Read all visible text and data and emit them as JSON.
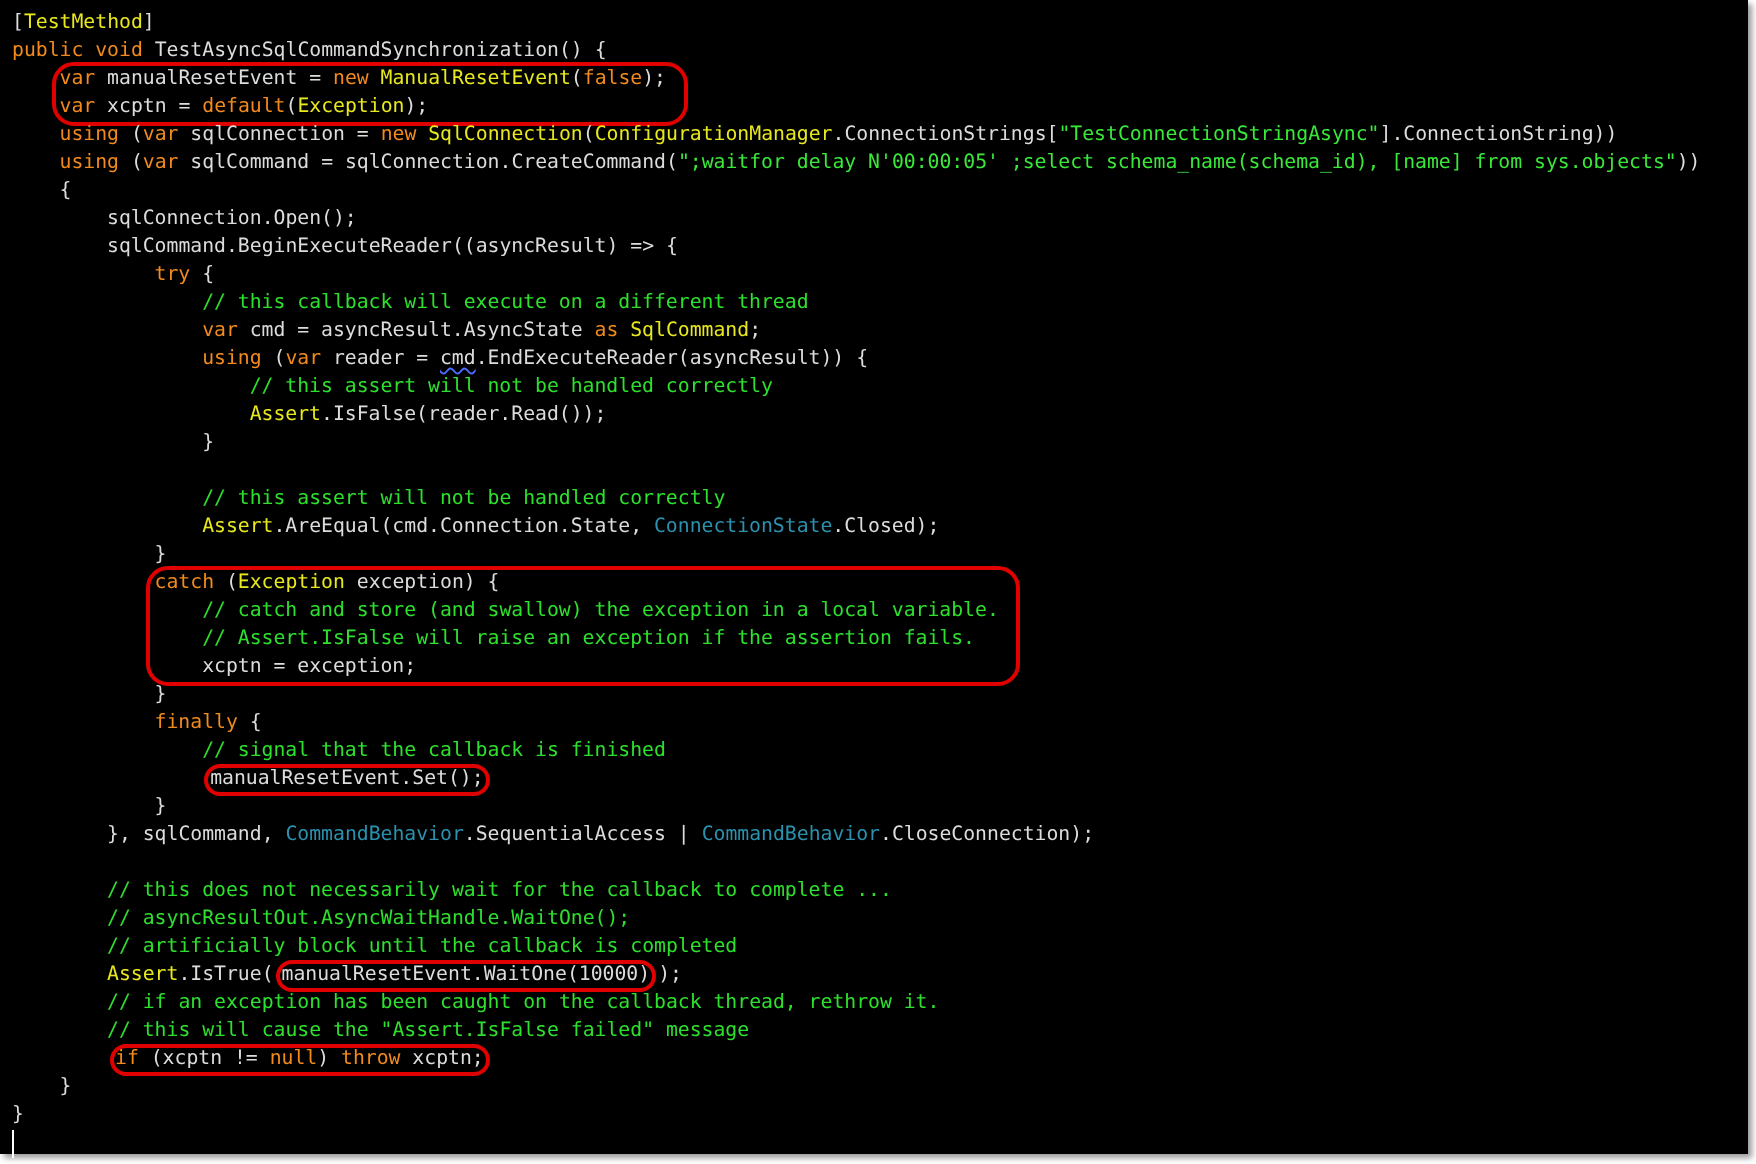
{
  "editor": {
    "lines": [
      {
        "kind": "line",
        "tokens": [
          {
            "kind": "plain",
            "text": "["
          },
          {
            "kind": "type",
            "text": "TestMethod"
          },
          {
            "kind": "plain",
            "text": "]"
          }
        ]
      },
      {
        "kind": "line",
        "tokens": [
          {
            "kind": "keyword",
            "text": "public void"
          },
          {
            "kind": "plain",
            "text": " TestAsyncSqlCommandSynchronization() {"
          }
        ],
        "children": [
          {
            "kind": "circled_group",
            "lines": [
              {
                "kind": "line",
                "tokens": [
                  {
                    "kind": "keyword",
                    "text": "var"
                  },
                  {
                    "kind": "plain",
                    "text": " manualResetEvent = "
                  },
                  {
                    "kind": "keyword",
                    "text": "new "
                  },
                  {
                    "kind": "type",
                    "text": "ManualResetEvent"
                  },
                  {
                    "kind": "plain",
                    "text": "("
                  },
                  {
                    "kind": "keyword",
                    "text": "false"
                  },
                  {
                    "kind": "plain",
                    "text": ");"
                  }
                ]
              },
              {
                "kind": "line",
                "tokens": [
                  {
                    "kind": "keyword",
                    "text": "var"
                  },
                  {
                    "kind": "plain",
                    "text": " xcptn = "
                  },
                  {
                    "kind": "keyword",
                    "text": "default"
                  },
                  {
                    "kind": "plain",
                    "text": "("
                  },
                  {
                    "kind": "type",
                    "text": "Exception"
                  },
                  {
                    "kind": "plain",
                    "text": ");"
                  }
                ]
              }
            ]
          },
          {
            "kind": "line",
            "tokens": [
              {
                "kind": "keyword",
                "text": "using"
              },
              {
                "kind": "plain",
                "text": " ("
              },
              {
                "kind": "keyword",
                "text": "var"
              },
              {
                "kind": "plain",
                "text": " sqlConnection = "
              },
              {
                "kind": "keyword",
                "text": "new "
              },
              {
                "kind": "type",
                "text": "SqlConnection"
              },
              {
                "kind": "plain",
                "text": "("
              },
              {
                "kind": "type",
                "text": "ConfigurationManager"
              },
              {
                "kind": "plain",
                "text": ".ConnectionStrings["
              },
              {
                "kind": "string",
                "text": "\"TestConnectionStringAsync\""
              },
              {
                "kind": "plain",
                "text": "].ConnectionString))"
              }
            ]
          },
          {
            "kind": "line",
            "tokens": [
              {
                "kind": "keyword",
                "text": "using"
              },
              {
                "kind": "plain",
                "text": " ("
              },
              {
                "kind": "keyword",
                "text": "var"
              },
              {
                "kind": "plain",
                "text": " sqlCommand = sqlConnection.CreateCommand("
              },
              {
                "kind": "string",
                "text": "\";waitfor delay N'00:00:05' ;select schema_name(schema_id), [name] from sys.objects\""
              },
              {
                "kind": "plain",
                "text": "))"
              }
            ]
          },
          {
            "kind": "line",
            "tokens": [
              {
                "kind": "plain",
                "text": "{"
              }
            ],
            "children": [
              {
                "kind": "line",
                "tokens": [
                  {
                    "kind": "plain",
                    "text": "sqlConnection.Open();"
                  }
                ]
              },
              {
                "kind": "line",
                "tokens": [
                  {
                    "kind": "plain",
                    "text": "sqlCommand.BeginExecuteReader((asyncResult) => {"
                  }
                ],
                "children": [
                  {
                    "kind": "line",
                    "tokens": [
                      {
                        "kind": "keyword",
                        "text": "try"
                      },
                      {
                        "kind": "plain",
                        "text": " {"
                      }
                    ],
                    "children": [
                      {
                        "kind": "line",
                        "tokens": [
                          {
                            "kind": "comment",
                            "text": "// this callback will execute on a different thread"
                          }
                        ]
                      },
                      {
                        "kind": "line",
                        "tokens": [
                          {
                            "kind": "keyword",
                            "text": "var"
                          },
                          {
                            "kind": "plain",
                            "text": " cmd = asyncResult.AsyncState "
                          },
                          {
                            "kind": "keyword",
                            "text": "as "
                          },
                          {
                            "kind": "type",
                            "text": "SqlCommand"
                          },
                          {
                            "kind": "plain",
                            "text": ";"
                          }
                        ]
                      },
                      {
                        "kind": "line",
                        "tokens": [
                          {
                            "kind": "keyword",
                            "text": "using"
                          },
                          {
                            "kind": "plain",
                            "text": " ("
                          },
                          {
                            "kind": "keyword",
                            "text": "var"
                          },
                          {
                            "kind": "plain",
                            "text": " reader = "
                          },
                          {
                            "kind": "warning",
                            "text": "cmd"
                          },
                          {
                            "kind": "plain",
                            "text": ".EndExecuteReader(asyncResult)) {"
                          }
                        ],
                        "children": [
                          {
                            "kind": "line",
                            "tokens": [
                              {
                                "kind": "comment",
                                "text": "// this assert will not be handled correctly"
                              }
                            ]
                          },
                          {
                            "kind": "line",
                            "tokens": [
                              {
                                "kind": "type",
                                "text": "Assert"
                              },
                              {
                                "kind": "plain",
                                "text": ".IsFalse(reader.Read());"
                              }
                            ]
                          }
                        ]
                      },
                      {
                        "kind": "line",
                        "tokens": [
                          {
                            "kind": "plain",
                            "text": "}"
                          }
                        ]
                      },
                      {
                        "kind": "blank"
                      },
                      {
                        "kind": "line",
                        "tokens": [
                          {
                            "kind": "comment",
                            "text": "// this assert will not be handled correctly"
                          }
                        ]
                      },
                      {
                        "kind": "line",
                        "tokens": [
                          {
                            "kind": "type",
                            "text": "Assert"
                          },
                          {
                            "kind": "plain",
                            "text": ".AreEqual(cmd.Connection.State, "
                          },
                          {
                            "kind": "enum",
                            "text": "ConnectionState"
                          },
                          {
                            "kind": "plain",
                            "text": ".Closed);"
                          }
                        ]
                      }
                    ]
                  },
                  {
                    "kind": "line",
                    "tokens": [
                      {
                        "kind": "plain",
                        "text": "}"
                      }
                    ]
                  },
                  {
                    "kind": "circled_group",
                    "lines": [
                      {
                        "kind": "line",
                        "tokens": [
                          {
                            "kind": "keyword",
                            "text": "catch"
                          },
                          {
                            "kind": "plain",
                            "text": " ("
                          },
                          {
                            "kind": "type",
                            "text": "Exception"
                          },
                          {
                            "kind": "plain",
                            "text": " exception) {"
                          }
                        ],
                        "children": [
                          {
                            "kind": "line",
                            "tokens": [
                              {
                                "kind": "comment",
                                "text": "// catch and store (and swallow) the exception in a local variable."
                              }
                            ]
                          },
                          {
                            "kind": "line",
                            "tokens": [
                              {
                                "kind": "comment",
                                "text": "// Assert.IsFalse will raise an exception if the assertion fails."
                              }
                            ]
                          },
                          {
                            "kind": "line",
                            "tokens": [
                              {
                                "kind": "plain",
                                "text": "xcptn = exception;"
                              }
                            ]
                          }
                        ]
                      }
                    ]
                  },
                  {
                    "kind": "line",
                    "tokens": [
                      {
                        "kind": "plain",
                        "text": "}"
                      }
                    ]
                  },
                  {
                    "kind": "line",
                    "tokens": [
                      {
                        "kind": "keyword",
                        "text": "finally"
                      },
                      {
                        "kind": "plain",
                        "text": " {"
                      }
                    ],
                    "children": [
                      {
                        "kind": "line",
                        "tokens": [
                          {
                            "kind": "comment",
                            "text": "// signal that the callback is finished"
                          }
                        ]
                      },
                      {
                        "kind": "line",
                        "tokens": [
                          {
                            "kind": "circle",
                            "tokens": [
                              {
                                "kind": "plain",
                                "text": "manualResetEvent.Set();"
                              }
                            ]
                          }
                        ]
                      }
                    ]
                  },
                  {
                    "kind": "line",
                    "tokens": [
                      {
                        "kind": "plain",
                        "text": "}"
                      }
                    ]
                  }
                ]
              },
              {
                "kind": "line",
                "tokens": [
                  {
                    "kind": "plain",
                    "text": "}, sqlCommand, "
                  },
                  {
                    "kind": "enum",
                    "text": "CommandBehavior"
                  },
                  {
                    "kind": "plain",
                    "text": ".SequentialAccess | "
                  },
                  {
                    "kind": "enum",
                    "text": "CommandBehavior"
                  },
                  {
                    "kind": "plain",
                    "text": ".CloseConnection);"
                  }
                ]
              },
              {
                "kind": "blank"
              },
              {
                "kind": "line",
                "tokens": [
                  {
                    "kind": "comment",
                    "text": "// this does not necessarily wait for the callback to complete ..."
                  }
                ]
              },
              {
                "kind": "line",
                "tokens": [
                  {
                    "kind": "comment",
                    "text": "// asyncResultOut.AsyncWaitHandle.WaitOne();"
                  }
                ]
              },
              {
                "kind": "line",
                "tokens": [
                  {
                    "kind": "comment",
                    "text": "// artificially block until the callback is completed"
                  }
                ]
              },
              {
                "kind": "line",
                "tokens": [
                  {
                    "kind": "type",
                    "text": "Assert"
                  },
                  {
                    "kind": "plain",
                    "text": ".IsTrue("
                  },
                  {
                    "kind": "circle",
                    "tokens": [
                      {
                        "kind": "plain",
                        "text": "manualResetEvent.WaitOne(10000)"
                      }
                    ]
                  },
                  {
                    "kind": "plain",
                    "text": ");"
                  }
                ]
              },
              {
                "kind": "line",
                "tokens": [
                  {
                    "kind": "comment",
                    "text": "// if an exception has been caught on the callback thread, rethrow it."
                  }
                ]
              },
              {
                "kind": "line",
                "tokens": [
                  {
                    "kind": "comment",
                    "text": "// this will cause the \"Assert.IsFalse failed\" message"
                  }
                ]
              },
              {
                "kind": "line",
                "tokens": [
                  {
                    "kind": "circle",
                    "tokens": [
                      {
                        "kind": "keyword",
                        "text": "if"
                      },
                      {
                        "kind": "plain",
                        "text": " (xcptn != "
                      },
                      {
                        "kind": "keyword",
                        "text": "null"
                      },
                      {
                        "kind": "plain",
                        "text": ") "
                      },
                      {
                        "kind": "keyword",
                        "text": "throw"
                      },
                      {
                        "kind": "plain",
                        "text": " xcptn;"
                      }
                    ]
                  }
                ]
              }
            ]
          },
          {
            "kind": "line",
            "tokens": [
              {
                "kind": "plain",
                "text": "}"
              }
            ]
          }
        ]
      },
      {
        "kind": "line",
        "tokens": [
          {
            "kind": "plain",
            "text": "}"
          }
        ]
      },
      {
        "kind": "cursor"
      }
    ]
  }
}
